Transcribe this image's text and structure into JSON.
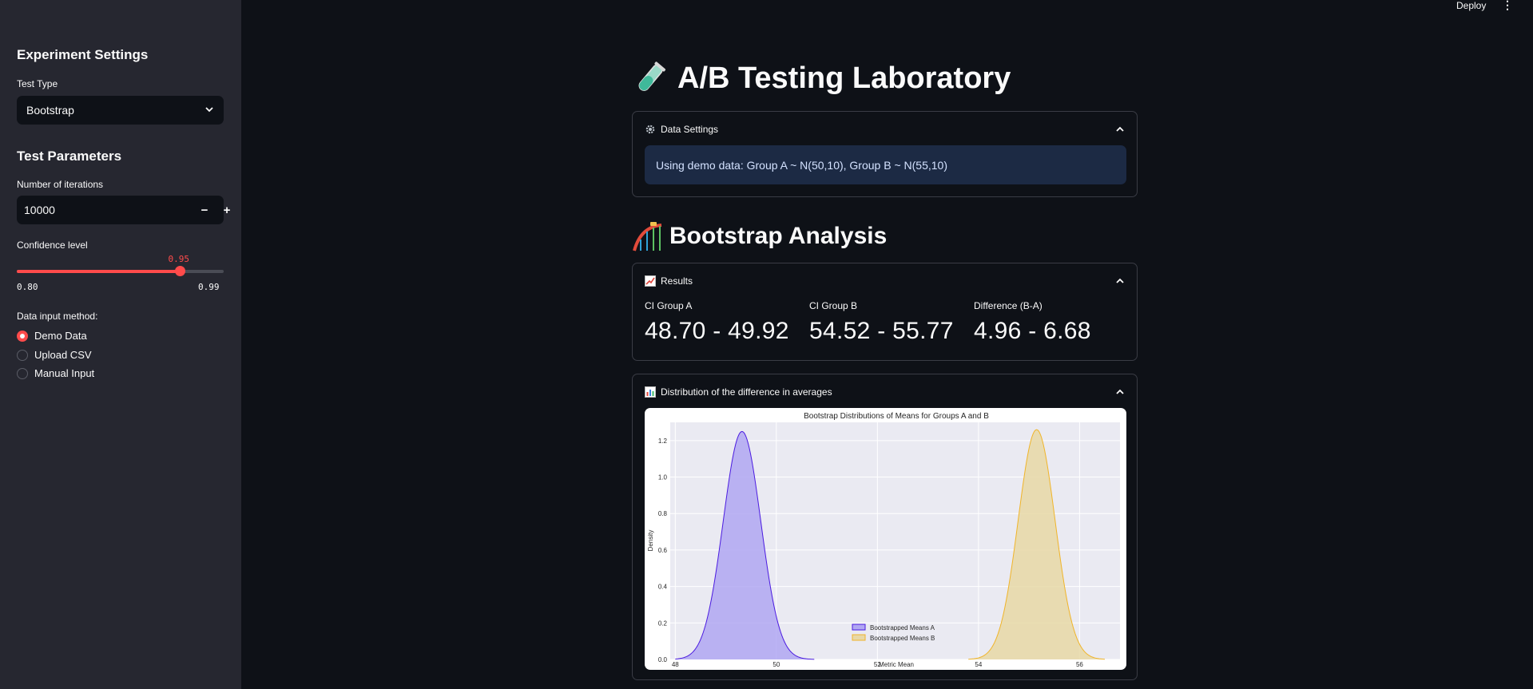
{
  "topbar": {
    "deploy_label": "Deploy",
    "menu_icon": "kebab-menu-icon"
  },
  "sidebar": {
    "experiment_heading": "Experiment Settings",
    "test_type_label": "Test Type",
    "test_type_value": "Bootstrap",
    "params_heading": "Test Parameters",
    "iterations_label": "Number of iterations",
    "iterations_value": "10000",
    "minus_label": "−",
    "plus_label": "+",
    "confidence_label": "Confidence level",
    "confidence_value": "0.95",
    "confidence_fraction": 0.7895,
    "confidence_min": "0.80",
    "confidence_max": "0.99",
    "data_input_label": "Data input method:",
    "data_input_options": [
      "Demo Data",
      "Upload CSV",
      "Manual Input"
    ],
    "data_input_selected": 0
  },
  "main": {
    "title": "A/B Testing Laboratory",
    "title_icon": "test-tube-icon",
    "data_settings": {
      "header": "Data Settings",
      "icon": "gear-icon",
      "info": "Using demo data: Group A ~ N(50,10), Group B ~ N(55,10)"
    },
    "analysis_title": "Bootstrap Analysis",
    "analysis_icon": "roller-coaster-icon",
    "results": {
      "header": "Results",
      "icon": "chart-increasing-icon",
      "metrics": [
        {
          "label": "CI Group A",
          "value": "48.70 - 49.92"
        },
        {
          "label": "CI Group B",
          "value": "54.52 - 55.77"
        },
        {
          "label": "Difference (B-A)",
          "value": "4.96 - 6.68"
        }
      ]
    },
    "distribution": {
      "header": "Distribution of the difference in averages",
      "icon": "bar-chart-icon"
    }
  },
  "colors": {
    "accent": "#ff4b4b",
    "series_a": "#4b1be0",
    "series_a_fill": "#b0a7f2",
    "series_b": "#f0b429",
    "series_b_fill": "#e8d8a6"
  },
  "chart_data": {
    "type": "area",
    "title": "Bootstrap Distributions of Means for Groups A and B",
    "xlabel": "Metric Mean",
    "ylabel": "Density",
    "xlim": [
      47.9,
      56.8
    ],
    "ylim": [
      0,
      1.3
    ],
    "xticks": [
      48,
      50,
      52,
      54,
      56
    ],
    "yticks": [
      0.0,
      0.2,
      0.4,
      0.6,
      0.8,
      1.0,
      1.2
    ],
    "grid": true,
    "legend_position": "bottom-center",
    "series": [
      {
        "name": "Bootstrapped Means A",
        "mean": 49.32,
        "peak": 1.25,
        "support": [
          48.0,
          50.75
        ]
      },
      {
        "name": "Bootstrapped Means B",
        "mean": 55.15,
        "peak": 1.26,
        "support": [
          53.8,
          56.5
        ]
      }
    ]
  }
}
